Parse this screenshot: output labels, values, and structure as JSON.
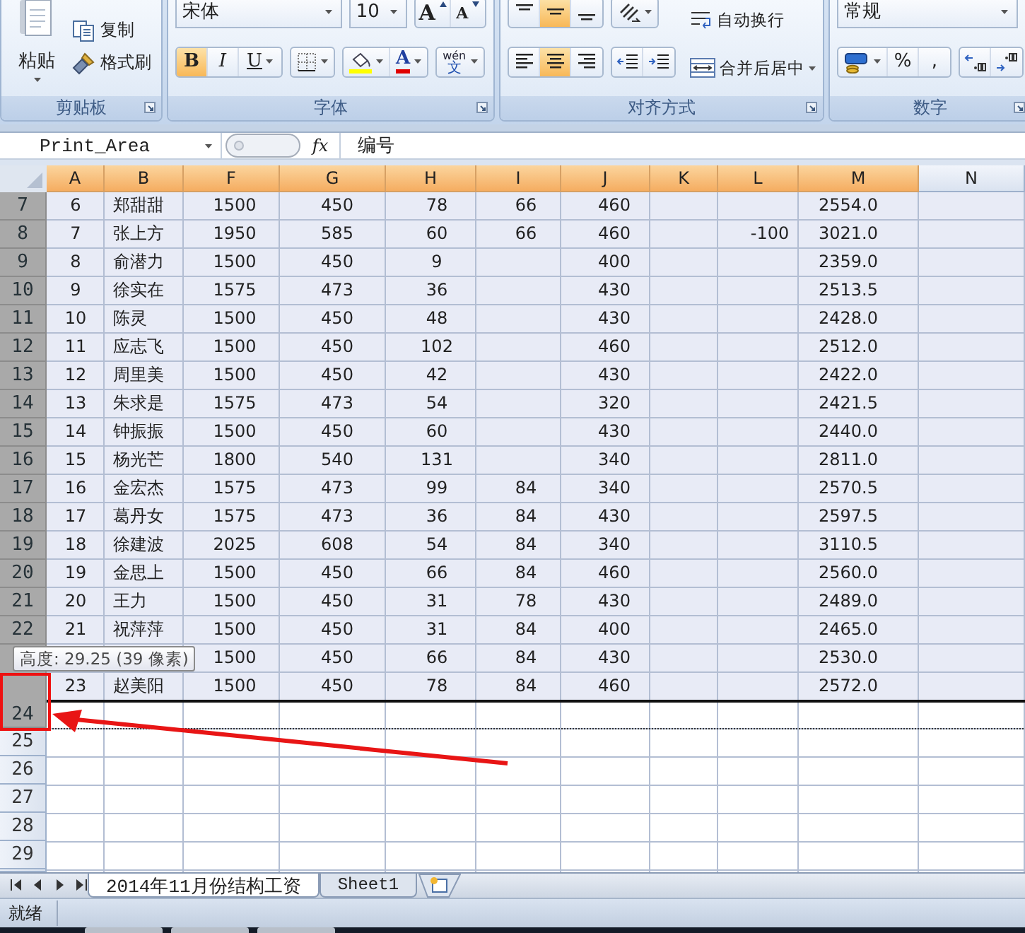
{
  "ribbon": {
    "clipboard": {
      "paste": "粘贴",
      "copy": "复制",
      "format_painter": "格式刷",
      "label": "剪贴板"
    },
    "font": {
      "name": "宋体",
      "size": "10",
      "grow": "A",
      "shrink": "A",
      "styles": [
        {
          "kind": "bold",
          "label": "B",
          "selected": true
        },
        {
          "kind": "italic",
          "label": "I",
          "selected": false
        },
        {
          "kind": "underline",
          "label": "U",
          "selected": false
        }
      ],
      "font_color": "A",
      "phonetic_top": "wén",
      "phonetic": "文",
      "label": "字体"
    },
    "alignment": {
      "vertical": [
        {
          "kind": "top",
          "selected": false
        },
        {
          "kind": "middle",
          "selected": true
        },
        {
          "kind": "bottom",
          "selected": false
        }
      ],
      "horizontal": [
        {
          "kind": "left",
          "selected": false
        },
        {
          "kind": "center",
          "selected": true
        },
        {
          "kind": "right",
          "selected": false
        }
      ],
      "wrap": "自动换行",
      "merge": "合并后居中",
      "label": "对齐方式"
    },
    "number": {
      "format": "常规",
      "percent": "%",
      "comma": ",",
      "label": "数字"
    }
  },
  "formula_bar": {
    "name_box": "Print_Area",
    "fx": "fx",
    "value": "编号"
  },
  "columns": [
    {
      "label": "A",
      "selected": true
    },
    {
      "label": "B",
      "selected": true
    },
    {
      "label": "F",
      "selected": true
    },
    {
      "label": "G",
      "selected": true
    },
    {
      "label": "H",
      "selected": true
    },
    {
      "label": "I",
      "selected": true
    },
    {
      "label": "J",
      "selected": true
    },
    {
      "label": "K",
      "selected": true
    },
    {
      "label": "L",
      "selected": true
    },
    {
      "label": "M",
      "selected": true
    },
    {
      "label": "N",
      "selected": false
    }
  ],
  "row_headers": [
    {
      "label": "7",
      "selected": true,
      "kind": "normal"
    },
    {
      "label": "8",
      "selected": true,
      "kind": "normal"
    },
    {
      "label": "9",
      "selected": true,
      "kind": "normal"
    },
    {
      "label": "10",
      "selected": true,
      "kind": "normal"
    },
    {
      "label": "11",
      "selected": true,
      "kind": "normal"
    },
    {
      "label": "12",
      "selected": true,
      "kind": "normal"
    },
    {
      "label": "13",
      "selected": true,
      "kind": "normal"
    },
    {
      "label": "14",
      "selected": true,
      "kind": "normal"
    },
    {
      "label": "15",
      "selected": true,
      "kind": "normal"
    },
    {
      "label": "16",
      "selected": true,
      "kind": "normal"
    },
    {
      "label": "17",
      "selected": true,
      "kind": "normal"
    },
    {
      "label": "18",
      "selected": true,
      "kind": "normal"
    },
    {
      "label": "19",
      "selected": true,
      "kind": "normal"
    },
    {
      "label": "20",
      "selected": true,
      "kind": "normal"
    },
    {
      "label": "21",
      "selected": true,
      "kind": "normal"
    },
    {
      "label": "22",
      "selected": true,
      "kind": "normal"
    },
    {
      "label": "24",
      "selected": true,
      "kind": "tall"
    },
    {
      "label": "25",
      "selected": false,
      "kind": "normal"
    },
    {
      "label": "26",
      "selected": false,
      "kind": "normal"
    },
    {
      "label": "27",
      "selected": false,
      "kind": "normal"
    },
    {
      "label": "28",
      "selected": false,
      "kind": "normal"
    },
    {
      "label": "29",
      "selected": false,
      "kind": "normal"
    }
  ],
  "rows": [
    {
      "cells": [
        "6",
        "郑甜甜",
        "1500",
        "450",
        "78",
        "66",
        "460",
        null,
        null,
        "2554.0"
      ]
    },
    {
      "cells": [
        "7",
        "张上方",
        "1950",
        "585",
        "60",
        "66",
        "460",
        null,
        "-100",
        "3021.0"
      ]
    },
    {
      "cells": [
        "8",
        "俞潜力",
        "1500",
        "450",
        "9",
        null,
        "400",
        null,
        null,
        "2359.0"
      ]
    },
    {
      "cells": [
        "9",
        "徐实在",
        "1575",
        "473",
        "36",
        null,
        "430",
        null,
        null,
        "2513.5"
      ]
    },
    {
      "cells": [
        "10",
        "陈灵",
        "1500",
        "450",
        "48",
        null,
        "430",
        null,
        null,
        "2428.0"
      ]
    },
    {
      "cells": [
        "11",
        "应志飞",
        "1500",
        "450",
        "102",
        null,
        "460",
        null,
        null,
        "2512.0"
      ]
    },
    {
      "cells": [
        "12",
        "周里美",
        "1500",
        "450",
        "42",
        null,
        "430",
        null,
        null,
        "2422.0"
      ]
    },
    {
      "cells": [
        "13",
        "朱求是",
        "1575",
        "473",
        "54",
        null,
        "320",
        null,
        null,
        "2421.5"
      ]
    },
    {
      "cells": [
        "14",
        "钟振振",
        "1500",
        "450",
        "60",
        null,
        "430",
        null,
        null,
        "2440.0"
      ]
    },
    {
      "cells": [
        "15",
        "杨光芒",
        "1800",
        "540",
        "131",
        null,
        "340",
        null,
        null,
        "2811.0"
      ]
    },
    {
      "cells": [
        "16",
        "金宏杰",
        "1575",
        "473",
        "99",
        "84",
        "340",
        null,
        null,
        "2570.5"
      ]
    },
    {
      "cells": [
        "17",
        "葛丹女",
        "1575",
        "473",
        "36",
        "84",
        "430",
        null,
        null,
        "2597.5"
      ]
    },
    {
      "cells": [
        "18",
        "徐建波",
        "2025",
        "608",
        "54",
        "84",
        "340",
        null,
        null,
        "3110.5"
      ]
    },
    {
      "cells": [
        "19",
        "金思上",
        "1500",
        "450",
        "66",
        "84",
        "460",
        null,
        null,
        "2560.0"
      ]
    },
    {
      "cells": [
        "20",
        "王力",
        "1500",
        "450",
        "31",
        "78",
        "430",
        null,
        null,
        "2489.0"
      ]
    },
    {
      "cells": [
        "21",
        "祝萍萍",
        "1500",
        "450",
        "31",
        "84",
        "400",
        null,
        null,
        "2465.0"
      ]
    },
    {
      "cells": [
        null,
        null,
        "1500",
        "450",
        "66",
        "84",
        "430",
        null,
        null,
        "2530.0"
      ]
    },
    {
      "cells": [
        "23",
        "赵美阳",
        "1500",
        "450",
        "78",
        "84",
        "460",
        null,
        null,
        "2572.0"
      ]
    }
  ],
  "tooltip": "高度: 29.25 (39 像素)",
  "sheet_tabs": [
    {
      "label": "2014年11月份结构工资",
      "selected": true
    },
    {
      "label": "Sheet1",
      "selected": false
    }
  ],
  "status_bar": "就绪"
}
